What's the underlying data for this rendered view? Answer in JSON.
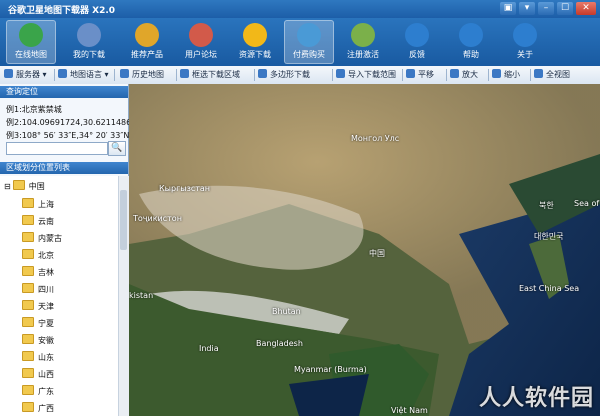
{
  "window": {
    "title": "谷歌卫星地图下载器 X2.0",
    "buttons": [
      "▣",
      "▾",
      "–",
      "☐",
      "✕"
    ]
  },
  "ribbon": [
    {
      "label": "在线地图",
      "icon": "globe-icon",
      "color": "#3aa44a",
      "active": true
    },
    {
      "label": "我的下载",
      "icon": "download-list-icon",
      "color": "#6a8fc8"
    },
    {
      "label": "推荐产品",
      "icon": "products-icon",
      "color": "#e0a62a"
    },
    {
      "label": "用户论坛",
      "icon": "users-icon",
      "color": "#d25a4a"
    },
    {
      "label": "资源下载",
      "icon": "resource-download-icon",
      "color": "#f2b818"
    },
    {
      "label": "付费购买",
      "icon": "purchase-icon",
      "color": "#4a9ad6",
      "active": true
    },
    {
      "label": "注册激活",
      "icon": "register-icon",
      "color": "#7bb04a"
    },
    {
      "label": "反馈",
      "icon": "feedback-icon",
      "color": "#2d7ecf"
    },
    {
      "label": "帮助",
      "icon": "help-icon",
      "color": "#2d7ecf"
    },
    {
      "label": "关于",
      "icon": "about-icon",
      "color": "#2d7ecf"
    }
  ],
  "toolbar": [
    {
      "label": "服务器 ▾",
      "icon": "server-icon"
    },
    {
      "label": "地图语言 ▾",
      "icon": "language-icon"
    },
    {
      "label": "历史地图",
      "icon": "history-icon"
    },
    {
      "label": "框选下载区域",
      "icon": "select-area-icon"
    },
    {
      "label": "多边形下载",
      "icon": "polygon-icon"
    },
    {
      "label": "导入下载范围",
      "icon": "import-icon"
    },
    {
      "label": "平移",
      "icon": "pan-icon"
    },
    {
      "label": "放大",
      "icon": "zoom-in-icon"
    },
    {
      "label": "缩小",
      "icon": "zoom-out-icon"
    },
    {
      "label": "全视图",
      "icon": "full-view-icon"
    }
  ],
  "sidebar": {
    "query_header": "查询定位",
    "examples": [
      "例1:北京紫禁城",
      "例2:104.09691724,30.62114865",
      "例3:108° 56′ 33″E,34° 20′ 33″N"
    ],
    "search_value": "",
    "search_button": "🔍",
    "region_header": "区域划分位置列表",
    "root": "中国",
    "provinces": [
      "上海",
      "云南",
      "内蒙古",
      "北京",
      "吉林",
      "四川",
      "天津",
      "宁夏",
      "安徽",
      "山东",
      "山西",
      "广东",
      "广西"
    ]
  },
  "map": {
    "labels": [
      {
        "text": "Монгол Улс"
      },
      {
        "text": "Кыргызстан"
      },
      {
        "text": "Тоҷикистон"
      },
      {
        "text": "中国"
      },
      {
        "text": "Bhutan"
      },
      {
        "text": "India"
      },
      {
        "text": "Bangladesh"
      },
      {
        "text": "Myanmar (Burma)"
      },
      {
        "text": "Việt Nam"
      },
      {
        "text": "East China Sea"
      },
      {
        "text": "대한민국"
      },
      {
        "text": "북한"
      },
      {
        "text": "Sea of Japan"
      },
      {
        "text": "kistan"
      }
    ],
    "watermark": "人人软件园"
  }
}
